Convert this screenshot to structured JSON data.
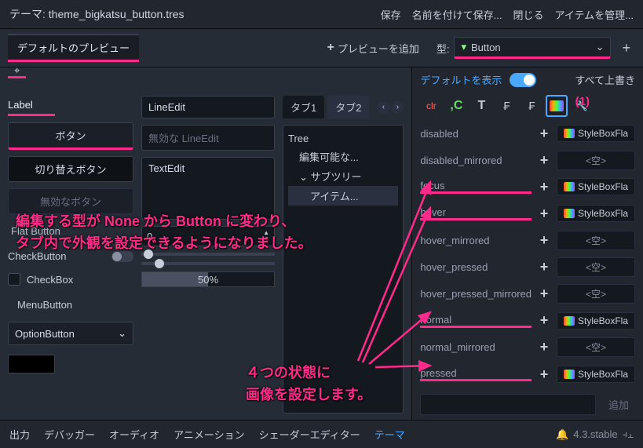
{
  "title": {
    "prefix": "テーマ: ",
    "file": "theme_bigkatsu_button.tres"
  },
  "titlebar": {
    "save": "保存",
    "save_as": "名前を付けて保存...",
    "close": "閉じる",
    "manage": "アイテムを管理..."
  },
  "header": {
    "default_preview_tab": "デフォルトのプレビュー",
    "add_preview": "プレビューを追加",
    "type_label": "型:",
    "type_value": "Button"
  },
  "preview": {
    "label": "Label",
    "button": "ボタン",
    "toggle_button": "切り替えボタン",
    "disabled_button": "無効なボタン",
    "flat_button": "Flat Button",
    "check_button": "CheckButton",
    "checkbox": "CheckBox",
    "menu_button": "MenuButton",
    "option_button": "OptionButton",
    "lineedit": "LineEdit",
    "disabled_lineedit": "無効な LineEdit",
    "textedit": "TextEdit",
    "spin_value": "0",
    "tab1": "タブ1",
    "tab2": "タブ2",
    "tree": "Tree",
    "editable": "編集可能な...",
    "subtree": "サブツリー",
    "item": "アイテム...",
    "progress": "50%"
  },
  "inspector": {
    "show_default": "デフォルトを表示",
    "override_all": "すべて上書き",
    "tabs": {
      "clr": "clr",
      "c": "C",
      "t": "T",
      "f1": "F",
      "f2": "F",
      "tool": "✦"
    },
    "props": [
      {
        "name": "disabled",
        "val": "StyleBoxFla",
        "type": "stylebox"
      },
      {
        "name": "disabled_mirrored",
        "val": "<空>",
        "type": "empty"
      },
      {
        "name": "focus",
        "val": "StyleBoxFla",
        "type": "stylebox"
      },
      {
        "name": "hover",
        "val": "StyleBoxFla",
        "type": "stylebox"
      },
      {
        "name": "hover_mirrored",
        "val": "<空>",
        "type": "empty"
      },
      {
        "name": "hover_pressed",
        "val": "<空>",
        "type": "empty"
      },
      {
        "name": "hover_pressed_mirrored",
        "val": "<空>",
        "type": "empty"
      },
      {
        "name": "normal",
        "val": "StyleBoxFla",
        "type": "stylebox"
      },
      {
        "name": "normal_mirrored",
        "val": "<空>",
        "type": "empty"
      },
      {
        "name": "pressed",
        "val": "StyleBoxFla",
        "type": "stylebox"
      }
    ],
    "add": "追加"
  },
  "bottom": {
    "output": "出力",
    "debugger": "デバッガー",
    "audio": "オーディオ",
    "anim": "アニメーション",
    "shader": "シェーダーエディター",
    "theme": "テーマ",
    "version": "4.3.stable"
  },
  "annotations": {
    "marker1": "(1)",
    "line1": "編集する型が None から Button に変わり、",
    "line2": "タブ内で外観を設定できるようになりました。",
    "line3": "４つの状態に",
    "line4": "画像を設定します。"
  }
}
